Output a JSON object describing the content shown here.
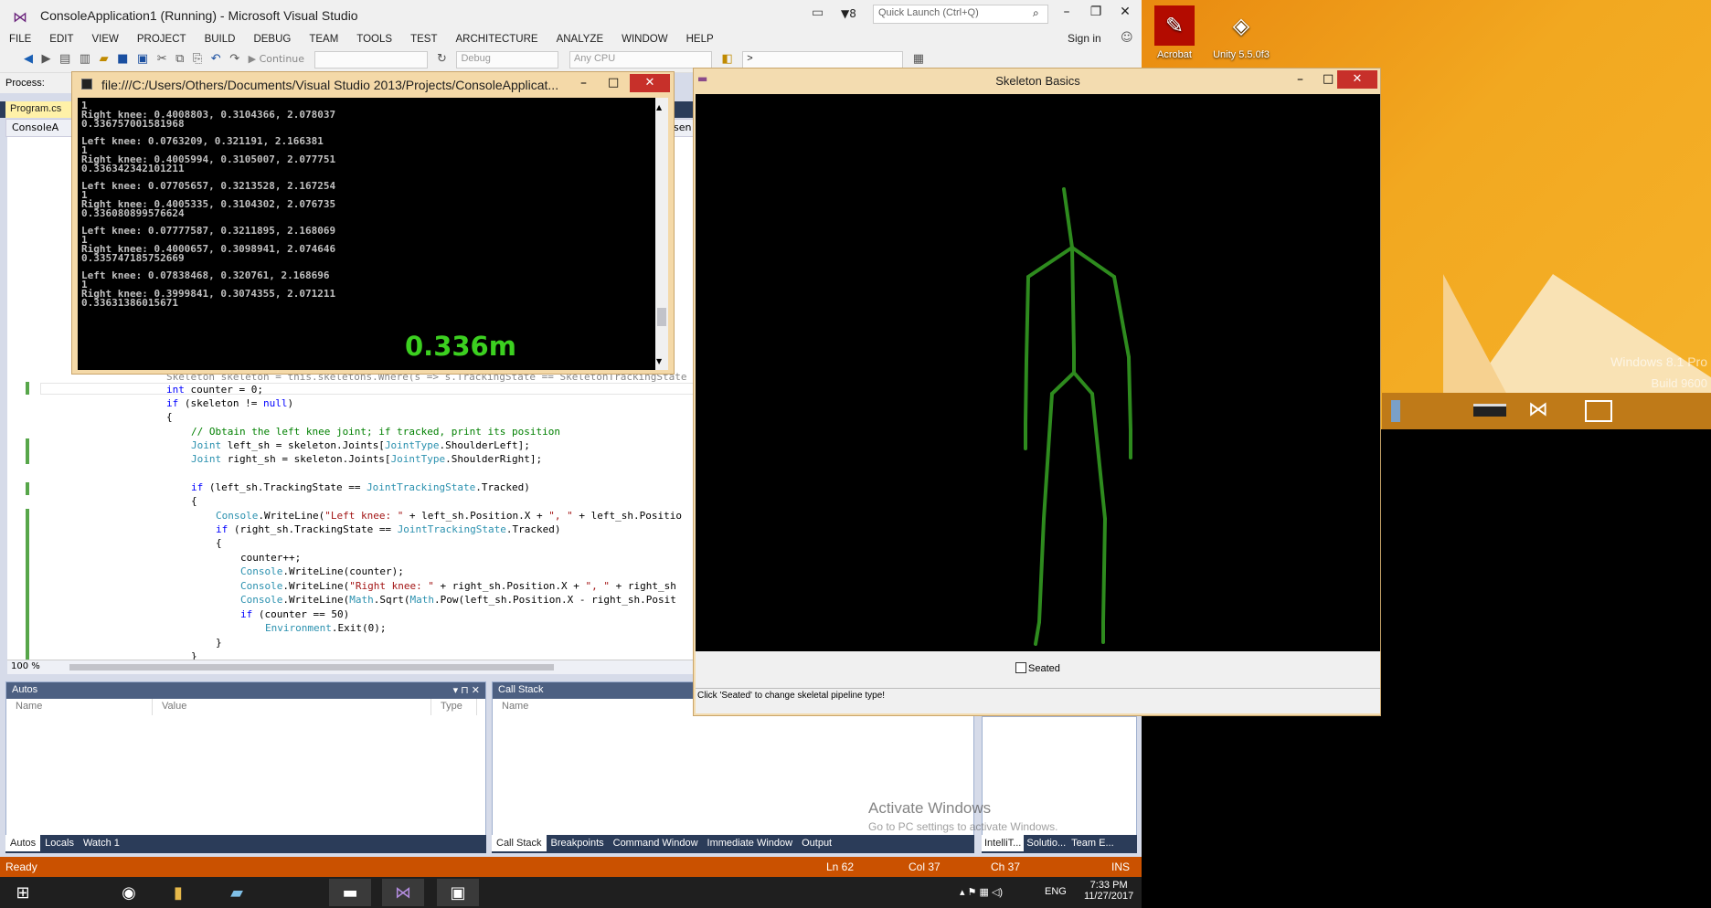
{
  "vs": {
    "title": "ConsoleApplication1 (Running) - Microsoft Visual Studio",
    "quick_launch_placeholder": "Quick Launch (Ctrl+Q)",
    "filter_count": "8",
    "sign_in": "Sign in",
    "menu": [
      "FILE",
      "EDIT",
      "VIEW",
      "PROJECT",
      "BUILD",
      "DEBUG",
      "TEAM",
      "TOOLS",
      "TEST",
      "ARCHITECTURE",
      "ANALYZE",
      "WINDOW",
      "HELP"
    ],
    "toolbar": {
      "continue": "Continue",
      "config": "Debug",
      "platform": "Any CPU",
      "find": ">"
    },
    "process_label": "Process:",
    "tab": "Program.cs",
    "nav_left": "ConsoleA",
    "nav_right": "sen",
    "zoom": "100 %"
  },
  "code": {
    "l0": "Skeleton skeleton = this.skeletons.Where(s => s.TrackingState == SkeletonTrackingState",
    "l1a": "int",
    "l1b": " counter = 0;",
    "l2a": "if",
    "l2b": " (skeleton != ",
    "l2c": "null",
    "l2d": ")",
    "l3": "{",
    "l4": "// Obtain the left knee joint; if tracked, print its position",
    "l5a": "Joint",
    "l5b": " left_sh = skeleton.Joints[",
    "l5c": "JointType",
    "l5d": ".ShoulderLeft];",
    "l6a": "Joint",
    "l6b": " right_sh = skeleton.Joints[",
    "l6c": "JointType",
    "l6d": ".ShoulderRight];",
    "l7a": "if",
    "l7b": " (left_sh.TrackingState == ",
    "l7c": "JointTrackingState",
    "l7d": ".Tracked)",
    "l8": "{",
    "l9a": "Console",
    "l9b": ".WriteLine(",
    "l9c": "\"Left knee: \"",
    "l9d": " + left_sh.Position.X + ",
    "l9e": "\", \"",
    "l9f": " + left_sh.Positio",
    "l10a": "if",
    "l10b": " (right_sh.TrackingState == ",
    "l10c": "JointTrackingState",
    "l10d": ".Tracked)",
    "l11": "{",
    "l12": "counter++;",
    "l13a": "Console",
    "l13b": ".WriteLine(counter);",
    "l14a": "Console",
    "l14b": ".WriteLine(",
    "l14c": "\"Right knee: \"",
    "l14d": " + right_sh.Position.X + ",
    "l14e": "\", \"",
    "l14f": " + right_sh",
    "l15a": "Console",
    "l15b": ".WriteLine(",
    "l15c": "Math",
    "l15d": ".Sqrt(",
    "l15e": "Math",
    "l15f": ".Pow(left_sh.Position.X - right_sh.Posit",
    "l16a": "if",
    "l16b": " (counter == 50)",
    "l17a": "Environment",
    "l17b": ".Exit(0);",
    "l18": "}",
    "l19": "}"
  },
  "autos": {
    "title": "Autos",
    "cols": [
      "Name",
      "Value",
      "Type"
    ],
    "tabs": [
      "Autos",
      "Locals",
      "Watch 1"
    ]
  },
  "callstack": {
    "title": "Call Stack",
    "cols": [
      "Name"
    ],
    "tabs": [
      "Call Stack",
      "Breakpoints",
      "Command Window",
      "Immediate Window",
      "Output"
    ]
  },
  "rightpane": {
    "tabs": [
      "IntelliT...",
      "Solutio...",
      "Team E..."
    ]
  },
  "status": {
    "ready": "Ready",
    "ln": "Ln 62",
    "col": "Col 37",
    "ch": "Ch 37",
    "ins": "INS"
  },
  "console": {
    "title": "file:///C:/Users/Others/Documents/Visual Studio 2013/Projects/ConsoleApplicat...",
    "lines": [
      "1",
      "Right knee: 0.4008803, 0.3104366, 2.078037",
      "0.336757001581968",
      "",
      "Left knee: 0.0763209, 0.321191, 2.166381",
      "1",
      "Right knee: 0.4005994, 0.3105007, 2.077751",
      "0.336342342101211",
      "",
      "Left knee: 0.07705657, 0.3213528, 2.167254",
      "1",
      "Right knee: 0.4005335, 0.3104302, 2.076735",
      "0.336080899576624",
      "",
      "Left knee: 0.07777587, 0.3211895, 2.168069",
      "1",
      "Right knee: 0.4000657, 0.3098941, 2.074646",
      "0.335747185752669",
      "",
      "Left knee: 0.07838468, 0.320761, 2.168696",
      "1",
      "Right knee: 0.3999841, 0.3074355, 2.071211",
      "0.33631386015671"
    ],
    "overlay": "0.336m"
  },
  "skeleton": {
    "title": "Skeleton Basics",
    "seated": "Seated",
    "status": "Click 'Seated' to change skeletal pipeline type!",
    "bone_color": "#2e8b1e"
  },
  "desktop": {
    "icons": [
      "Acrobat",
      "Unity 5.5.0f3"
    ],
    "watermark": "Windows 8.1 Pro",
    "build": "Build 9600",
    "activate": "Activate Windows",
    "activate_sub": "Go to PC settings to activate Windows."
  },
  "taskbar": {
    "lang": "ENG",
    "time": "7:33 PM",
    "date": "11/27/2017"
  }
}
